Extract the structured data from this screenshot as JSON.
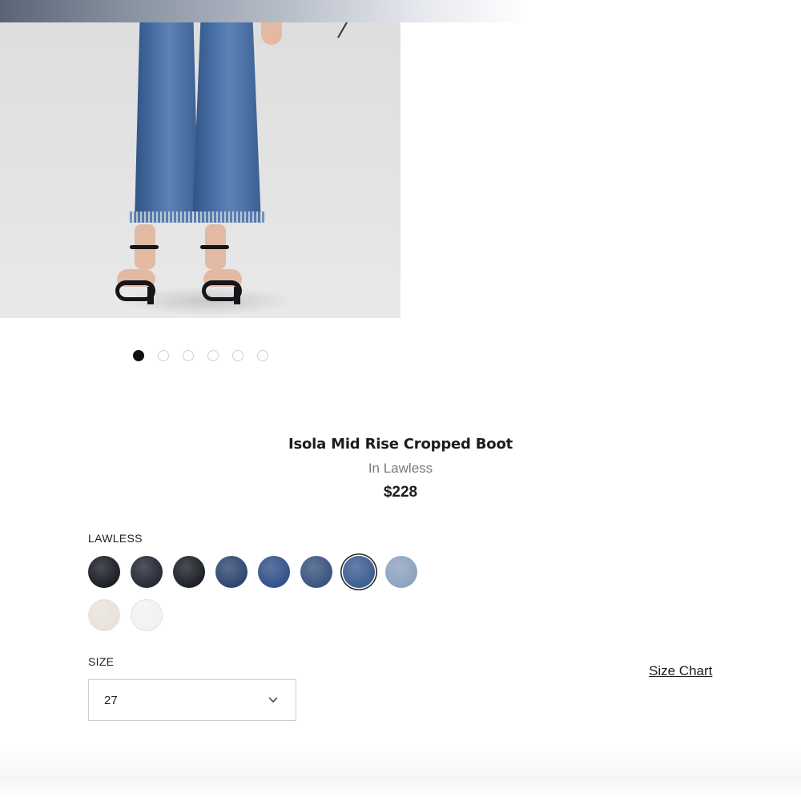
{
  "product": {
    "name": "Isola Mid Rise Cropped Boot",
    "colorway_line": "In Lawless",
    "price": "$228"
  },
  "gallery": {
    "dots_total": 6,
    "active_index": 0
  },
  "color": {
    "label": "LAWLESS",
    "swatches": [
      {
        "hex": "#1d1f26"
      },
      {
        "hex": "#252a36"
      },
      {
        "hex": "#1e2128"
      },
      {
        "hex": "#2f4872"
      },
      {
        "hex": "#34528a"
      },
      {
        "hex": "#3b5580"
      },
      {
        "hex": "#3e5f92",
        "selected": true
      },
      {
        "hex": "#8da3bf"
      },
      {
        "hex": "#e8e3da"
      },
      {
        "hex": "#f1f2f4"
      }
    ]
  },
  "size": {
    "label": "SIZE",
    "selected_value": "27",
    "size_chart_link": "Size Chart",
    "chevron_icon": "chevron-down-icon"
  }
}
